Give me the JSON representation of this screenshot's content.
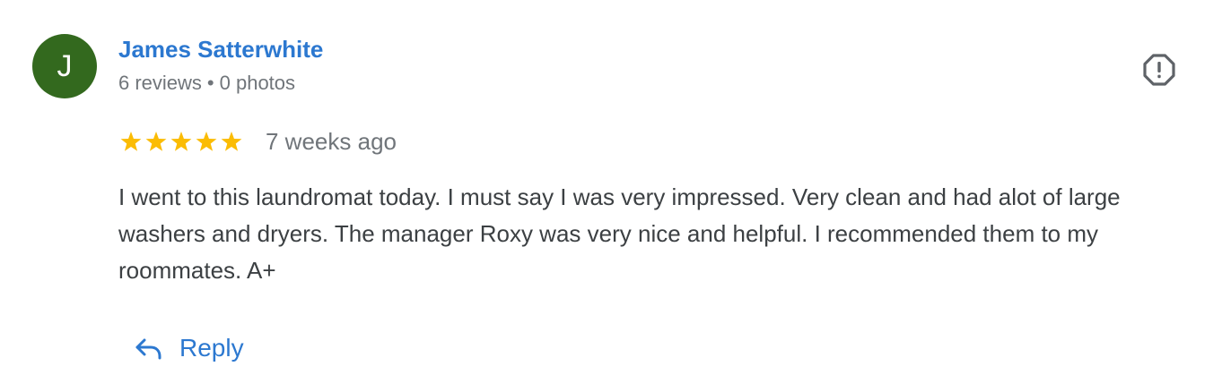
{
  "review": {
    "avatar_initial": "J",
    "author_name": "James Satterwhite",
    "reviews_count": "6 reviews",
    "separator": "•",
    "photos_count": "0 photos",
    "rating": 5,
    "rating_max": 5,
    "time_ago": "7 weeks ago",
    "text": "I went to this laundromat today. I must say I was very impressed. Very clean and had alot of large washers and dryers. The manager Roxy was very nice and helpful. I recommended them to my roommates. A+",
    "reply_label": "Reply"
  },
  "colors": {
    "avatar_bg": "#33691e",
    "link_blue": "#2c78d0",
    "star_gold": "#fbbc04",
    "meta_gray": "#70757a",
    "text_dark": "#3c4043"
  },
  "icons": {
    "flag": "report-flag-icon",
    "star": "star-icon",
    "reply": "reply-arrow-icon"
  }
}
